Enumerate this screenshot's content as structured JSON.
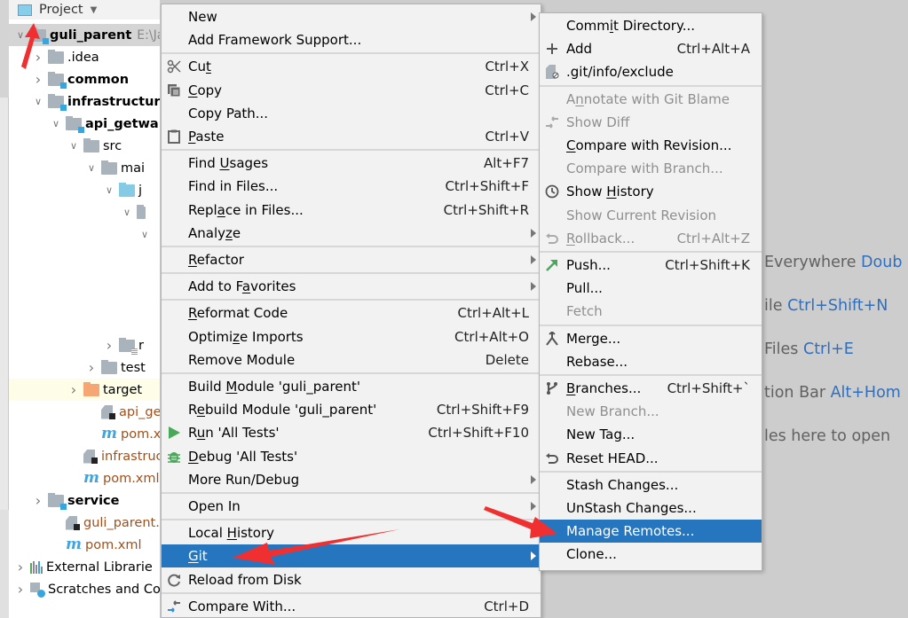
{
  "project_panel": {
    "title": "Project",
    "tree": [
      {
        "label": "guli_parent",
        "path": "E:\\Ja",
        "chevron": "down",
        "icon": "module-folder",
        "bold": true,
        "selected": true
      },
      {
        "label": ".idea",
        "chevron": "right",
        "icon": "folder"
      },
      {
        "label": "common",
        "chevron": "right",
        "icon": "module-folder",
        "bold": true
      },
      {
        "label": "infrastructur",
        "chevron": "down",
        "icon": "module-folder",
        "bold": true
      },
      {
        "label": "api_getwa",
        "chevron": "down",
        "icon": "module-folder",
        "bold": true
      },
      {
        "label": "src",
        "chevron": "down",
        "icon": "folder"
      },
      {
        "label": "mai",
        "chevron": "down",
        "icon": "folder"
      },
      {
        "label": "j",
        "chevron": "down",
        "icon": "source-folder"
      },
      {
        "label": "",
        "chevron": "down",
        "icon": "package"
      },
      {
        "label": "",
        "chevron": "down",
        "icon": ""
      },
      {
        "label": "r",
        "chevron": "right",
        "icon": "resources-folder"
      },
      {
        "label": "test",
        "chevron": "right",
        "icon": "folder"
      },
      {
        "label": "target",
        "chevron": "right",
        "icon": "excluded-folder",
        "highlight": true
      },
      {
        "label": "api_get",
        "icon": "iml-file",
        "brown": true
      },
      {
        "label": "pom.xn",
        "icon": "maven-file",
        "brown": true
      },
      {
        "label": "infrastruct",
        "icon": "iml-file",
        "brown": true
      },
      {
        "label": "pom.xml",
        "icon": "maven-file",
        "brown": true
      },
      {
        "label": "service",
        "chevron": "right",
        "icon": "module-folder",
        "bold": true
      },
      {
        "label": "guli_parent.ir",
        "icon": "iml-file",
        "brown": true
      },
      {
        "label": "pom.xml",
        "icon": "maven-file",
        "brown": true
      },
      {
        "label": "External Librarie",
        "chevron": "right",
        "icon": "libraries"
      },
      {
        "label": "Scratches and Co",
        "chevron": "right",
        "icon": "scratches"
      }
    ]
  },
  "editor_hints": [
    {
      "text": "Everywhere ",
      "shortcut": "Doub"
    },
    {
      "text": "ile ",
      "shortcut": "Ctrl+Shift+N"
    },
    {
      "text": "Files ",
      "shortcut": "Ctrl+E"
    },
    {
      "text": "tion Bar ",
      "shortcut": "Alt+Hom"
    },
    {
      "text": "les here to open",
      "shortcut": ""
    }
  ],
  "context_menu": {
    "items": [
      {
        "label": "New",
        "submenu": true
      },
      {
        "label": "Add Framework Support..."
      },
      {
        "sep": true
      },
      {
        "label": "Cut",
        "mnemonic": "t",
        "shortcut": "Ctrl+X",
        "icon": "scissors-icon"
      },
      {
        "label": "Copy",
        "mnemonic": "C",
        "shortcut": "Ctrl+C",
        "icon": "copy-icon"
      },
      {
        "label": "Copy Path..."
      },
      {
        "label": "Paste",
        "mnemonic": "P",
        "shortcut": "Ctrl+V",
        "icon": "clipboard-icon"
      },
      {
        "sep": true
      },
      {
        "label": "Find Usages",
        "mnemonic": "U",
        "shortcut": "Alt+F7"
      },
      {
        "label": "Find in Files...",
        "shortcut": "Ctrl+Shift+F"
      },
      {
        "label": "Replace in Files...",
        "mnemonic": "a",
        "shortcut": "Ctrl+Shift+R"
      },
      {
        "label": "Analyze",
        "mnemonic": "z",
        "submenu": true
      },
      {
        "sep": true
      },
      {
        "label": "Refactor",
        "mnemonic": "R",
        "submenu": true
      },
      {
        "sep": true
      },
      {
        "label": "Add to Favorites",
        "mnemonic": "a",
        "submenu": true
      },
      {
        "sep": true
      },
      {
        "label": "Reformat Code",
        "mnemonic": "R",
        "shortcut": "Ctrl+Alt+L"
      },
      {
        "label": "Optimize Imports",
        "mnemonic": "z",
        "shortcut": "Ctrl+Alt+O"
      },
      {
        "label": "Remove Module",
        "shortcut": "Delete"
      },
      {
        "sep": true
      },
      {
        "label": "Build Module 'guli_parent'",
        "mnemonic": "M"
      },
      {
        "label": "Rebuild Module 'guli_parent'",
        "mnemonic": "e",
        "shortcut": "Ctrl+Shift+F9"
      },
      {
        "label": "Run 'All Tests'",
        "mnemonic": "u",
        "shortcut": "Ctrl+Shift+F10",
        "icon": "run-icon"
      },
      {
        "label": "Debug 'All Tests'",
        "mnemonic": "D",
        "icon": "debug-icon"
      },
      {
        "label": "More Run/Debug",
        "submenu": true
      },
      {
        "sep": true
      },
      {
        "label": "Open In",
        "submenu": true
      },
      {
        "sep": true
      },
      {
        "label": "Local History",
        "mnemonic": "H",
        "submenu": true
      },
      {
        "label": "Git",
        "mnemonic": "G",
        "submenu": true,
        "active": true
      },
      {
        "label": "Reload from Disk",
        "icon": "reload-icon"
      },
      {
        "sep": true
      },
      {
        "label": "Compare With...",
        "shortcut": "Ctrl+D",
        "icon": "compare-icon"
      }
    ]
  },
  "git_menu": {
    "items": [
      {
        "label": "Commit Directory...",
        "mnemonic": "i"
      },
      {
        "label": "Add",
        "shortcut": "Ctrl+Alt+A",
        "icon": "plus-icon"
      },
      {
        "label": ".git/info/exclude",
        "icon": "ignore-file-icon"
      },
      {
        "sep": true
      },
      {
        "label": "Annotate with Git Blame",
        "mnemonic": "n",
        "disabled": true
      },
      {
        "label": "Show Diff",
        "disabled": true,
        "icon": "diff-icon"
      },
      {
        "label": "Compare with Revision...",
        "mnemonic": "C"
      },
      {
        "label": "Compare with Branch...",
        "disabled": true
      },
      {
        "label": "Show History",
        "mnemonic": "H",
        "icon": "history-icon"
      },
      {
        "label": "Show Current Revision",
        "disabled": true
      },
      {
        "label": "Rollback...",
        "mnemonic": "R",
        "shortcut": "Ctrl+Alt+Z",
        "disabled": true,
        "icon": "rollback-icon"
      },
      {
        "sep": true
      },
      {
        "label": "Push...",
        "shortcut": "Ctrl+Shift+K",
        "icon": "push-icon"
      },
      {
        "label": "Pull..."
      },
      {
        "label": "Fetch",
        "disabled": true
      },
      {
        "sep": true
      },
      {
        "label": "Merge...",
        "icon": "merge-icon"
      },
      {
        "label": "Rebase..."
      },
      {
        "sep": true
      },
      {
        "label": "Branches...",
        "mnemonic": "B",
        "shortcut": "Ctrl+Shift+`",
        "icon": "branch-icon"
      },
      {
        "label": "New Branch...",
        "disabled": true
      },
      {
        "label": "New Tag..."
      },
      {
        "label": "Reset HEAD...",
        "icon": "reset-icon"
      },
      {
        "sep": true
      },
      {
        "label": "Stash Changes..."
      },
      {
        "label": "UnStash Changes..."
      },
      {
        "label": "Manage Remotes...",
        "active": true
      },
      {
        "label": "Clone..."
      }
    ]
  },
  "colors": {
    "selection": "#2675bf",
    "menu_bg": "#f2f2f2",
    "disabled_text": "#8f8f8f",
    "annotation_arrow": "#f03030",
    "shortcut_hint": "#2f6fbf"
  }
}
